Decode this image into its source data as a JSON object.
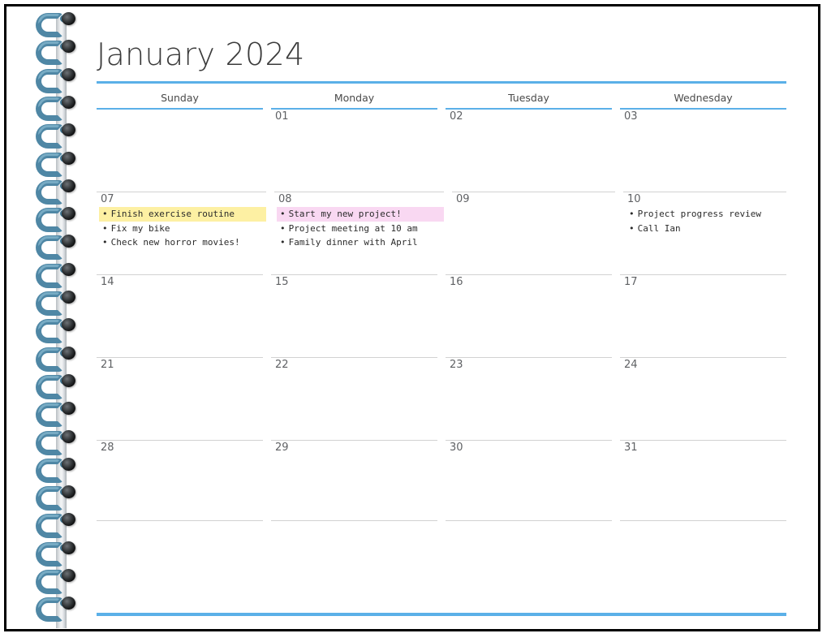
{
  "page": {
    "title": "January 2024",
    "accent_color": "#5bb0e8",
    "border_color": "#000000",
    "highlight_yellow": "#fdf0a3",
    "highlight_pink": "#f9d8f2",
    "spiral_color": "#4f87a5"
  },
  "weekdays": [
    {
      "label": "Sunday"
    },
    {
      "label": "Monday"
    },
    {
      "label": "Tuesday"
    },
    {
      "label": "Wednesday"
    }
  ],
  "weeks": [
    {
      "days": [
        {
          "num": "",
          "events": []
        },
        {
          "num": "01",
          "events": []
        },
        {
          "num": "02",
          "events": []
        },
        {
          "num": "03",
          "events": []
        }
      ]
    },
    {
      "days": [
        {
          "num": "07",
          "events": [
            {
              "text": "Finish exercise routine",
              "highlight": "yellow"
            },
            {
              "text": "Fix my bike",
              "highlight": "none"
            },
            {
              "text": "Check new horror movies!",
              "highlight": "none"
            }
          ]
        },
        {
          "num": "08",
          "events": [
            {
              "text": "Start my new project!",
              "highlight": "pink"
            },
            {
              "text": "Project meeting at 10 am",
              "highlight": "none"
            },
            {
              "text": "Family dinner with April",
              "highlight": "none"
            }
          ]
        },
        {
          "num": "09",
          "events": []
        },
        {
          "num": "10",
          "events": [
            {
              "text": "Project progress review",
              "highlight": "none"
            },
            {
              "text": "Call Ian",
              "highlight": "none"
            }
          ]
        }
      ]
    },
    {
      "days": [
        {
          "num": "14",
          "events": []
        },
        {
          "num": "15",
          "events": []
        },
        {
          "num": "16",
          "events": []
        },
        {
          "num": "17",
          "events": []
        }
      ]
    },
    {
      "days": [
        {
          "num": "21",
          "events": []
        },
        {
          "num": "22",
          "events": []
        },
        {
          "num": "23",
          "events": []
        },
        {
          "num": "24",
          "events": []
        }
      ]
    },
    {
      "days": [
        {
          "num": "28",
          "events": []
        },
        {
          "num": "29",
          "events": []
        },
        {
          "num": "30",
          "events": []
        },
        {
          "num": "31",
          "events": []
        }
      ]
    }
  ],
  "bullet": "•",
  "spiral": {
    "coil_count": 22
  }
}
